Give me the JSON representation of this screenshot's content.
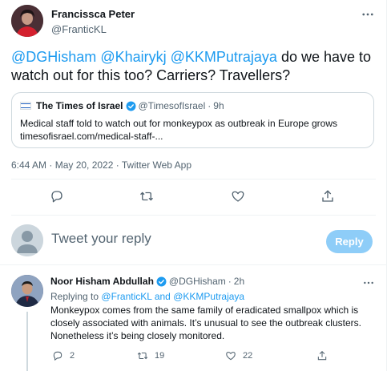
{
  "tweet": {
    "author_name": "Francissca Peter",
    "author_handle": "@FranticKL",
    "mentions": [
      "@DGHisham",
      "@Khairykj",
      "@KKMPutrajaya"
    ],
    "text_rest": "do we have to watch out for this too? Carriers? Travellers?",
    "timestamp": "6:44 AM · May 20, 2022 · Twitter Web App",
    "icons": {
      "more": "more-icon",
      "reply": "reply-icon",
      "retweet": "retweet-icon",
      "like": "heart-icon",
      "share": "share-icon"
    }
  },
  "quote": {
    "source_name": "The Times of Israel",
    "source_handle": "@TimesofIsrael",
    "age": "9h",
    "headline": "Medical staff told to watch out for monkeypox as outbreak in Europe grows",
    "link": "timesofisrael.com/medical-staff-..."
  },
  "reply_box": {
    "placeholder": "Tweet your reply",
    "button_label": "Reply"
  },
  "reply_tweet": {
    "author_name": "Noor Hisham Abdullah",
    "author_handle": "@DGHisham",
    "age": "2h",
    "replying_prefix": "Replying to",
    "replying_user1": "@FranticKL",
    "replying_and": "and",
    "replying_user2": "@KKMPutrajaya",
    "text": "Monkeypox comes from the same family of eradicated smallpox which is closely associated with animals. It’s unusual to see the outbreak clusters. Nonetheless it’s being closely monitored.",
    "reply_count": "2",
    "retweet_count": "19",
    "like_count": "22"
  },
  "colors": {
    "accent": "#1d9bf0",
    "secondary_text": "#536471",
    "reply_button_disabled": "#8ecdf8",
    "border": "#cfd9de"
  }
}
